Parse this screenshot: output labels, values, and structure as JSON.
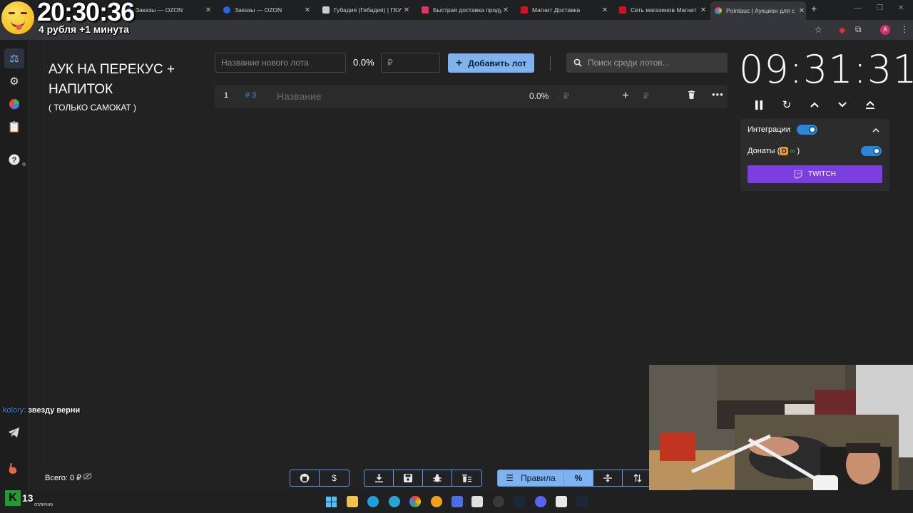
{
  "browser": {
    "tabs": [
      {
        "title": "Заказы — OZON",
        "color": "#2462e8"
      },
      {
        "title": "Заказы — OZON",
        "color": "#2462e8"
      },
      {
        "title": "Губадия (Гебадия) | ГБУ",
        "color": "#cccccc"
      },
      {
        "title": "Быстрая доставка проду",
        "color": "#e4335f"
      },
      {
        "title": "Магнит Доставка",
        "color": "#d4111e"
      },
      {
        "title": "Сеть магазинов Магнит",
        "color": "#d4111e"
      },
      {
        "title": "Pointauc | Аукцион для с",
        "color": "#9b59d0"
      }
    ],
    "profile_initial": "A"
  },
  "overlay": {
    "clock": "20:30:36",
    "subtitle": "4 рубля +1 минута"
  },
  "auction": {
    "title": "АУК НА ПЕРЕКУС + НАПИТОК",
    "subtitle": "( ТОЛЬКО САМОКАТ )",
    "new_lot_placeholder": "Название нового лота",
    "percent": "0.0%",
    "amount_placeholder": "₽",
    "add_lot_label": "Добавить лот",
    "search_placeholder": "Поиск среди лотов...",
    "lots": [
      {
        "index": "1",
        "tag": "# 3",
        "name_placeholder": "Название",
        "percent": "0.0%",
        "currency": "₽",
        "add_currency": "₽"
      }
    ]
  },
  "timer": {
    "value": "09:31:31"
  },
  "integrations": {
    "label": "Интеграции",
    "donations_prefix": "Донаты (",
    "donations_suffix": ")",
    "da_letter": "D",
    "twitch_label": "TWITCH"
  },
  "chat": {
    "user": "kolory:",
    "message": "звезду верни"
  },
  "footer": {
    "total": "Всего: 0 ₽",
    "rules_label": "Правила"
  },
  "kick": {
    "count": "13",
    "status": "отлично"
  },
  "colors": {
    "accent": "#7fb3f0",
    "twitch": "#7b3fe0",
    "toggle": "#2a86d8"
  }
}
